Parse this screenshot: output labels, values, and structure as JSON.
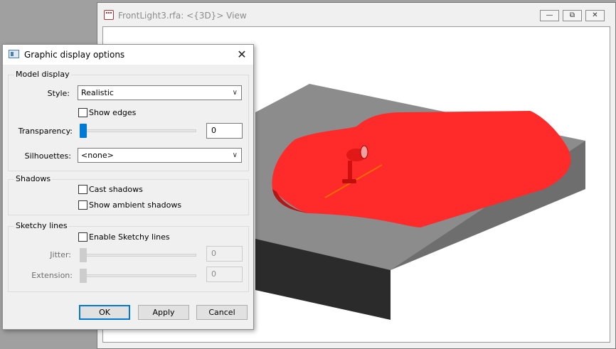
{
  "view_window": {
    "title": "FrontLight3.rfa: <{3D}> View",
    "minimize_glyph": "—",
    "restore_glyph": "⧉",
    "close_glyph": "✕",
    "icon": "family-document-icon"
  },
  "dialog": {
    "title": "Graphic display options",
    "close_glyph": "✕",
    "icon": "dialog-window-icon",
    "model_display": {
      "group_label": "Model display",
      "style_label": "Style:",
      "style_value": "Realistic",
      "show_edges_label": "Show edges",
      "show_edges_checked": false,
      "transparency_label": "Transparency:",
      "transparency_value": "0",
      "transparency_level": 0,
      "silhouettes_label": "Silhouettes:",
      "silhouettes_value": "<none>"
    },
    "shadows": {
      "group_label": "Shadows",
      "cast_shadows_label": "Cast shadows",
      "cast_shadows_checked": false,
      "ambient_shadows_label": "Show ambient shadows",
      "ambient_shadows_checked": false
    },
    "sketchy_lines": {
      "group_label": "Sketchy lines",
      "enable_label": "Enable Sketchy lines",
      "enable_checked": false,
      "jitter_label": "Jitter:",
      "jitter_value": "0",
      "extension_label": "Extension:",
      "extension_value": "0"
    },
    "buttons": {
      "ok": "OK",
      "apply": "Apply",
      "cancel": "Cancel"
    },
    "dropdown_arrow": "∨"
  },
  "colors": {
    "slider_thumb": "#0078d7",
    "light_glow": "#ff2a2a",
    "slab_top": "#8c8c8c",
    "slab_side": "#6e6e6e",
    "slab_front": "#2b2b2b"
  }
}
